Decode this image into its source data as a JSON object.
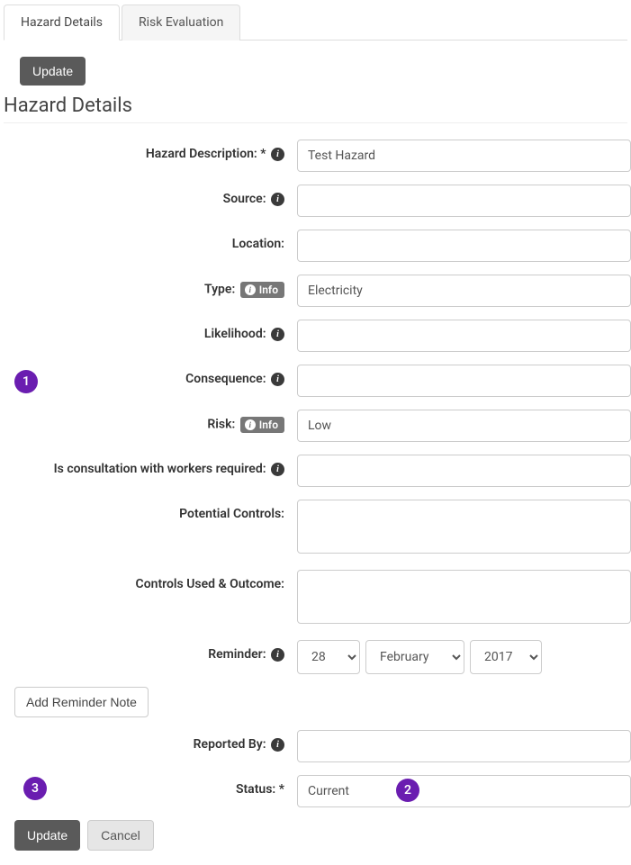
{
  "tabs": {
    "hazard_details": "Hazard Details",
    "risk_evaluation": "Risk Evaluation"
  },
  "buttons": {
    "update": "Update",
    "cancel": "Cancel",
    "add_reminder_note": "Add Reminder Note",
    "info_badge": "Info"
  },
  "page_title": "Hazard Details",
  "labels": {
    "hazard_description": "Hazard Description: *",
    "source": "Source:",
    "location": "Location:",
    "type": "Type:",
    "likelihood": "Likelihood:",
    "consequence": "Consequence:",
    "risk": "Risk:",
    "consultation": "Is consultation with workers required:",
    "potential_controls": "Potential Controls:",
    "controls_used": "Controls Used & Outcome:",
    "reminder": "Reminder:",
    "reported_by": "Reported By:",
    "status": "Status: *"
  },
  "values": {
    "hazard_description": "Test Hazard",
    "source": "",
    "location": "",
    "type": "Electricity",
    "likelihood": "",
    "consequence": "",
    "risk": "Low",
    "consultation": "",
    "potential_controls": "",
    "controls_used": "",
    "reminder_day": "28",
    "reminder_month": "February",
    "reminder_year": "2017",
    "reported_by": "",
    "status": "Current"
  },
  "annotations": {
    "a1": "1",
    "a2": "2",
    "a3": "3"
  }
}
